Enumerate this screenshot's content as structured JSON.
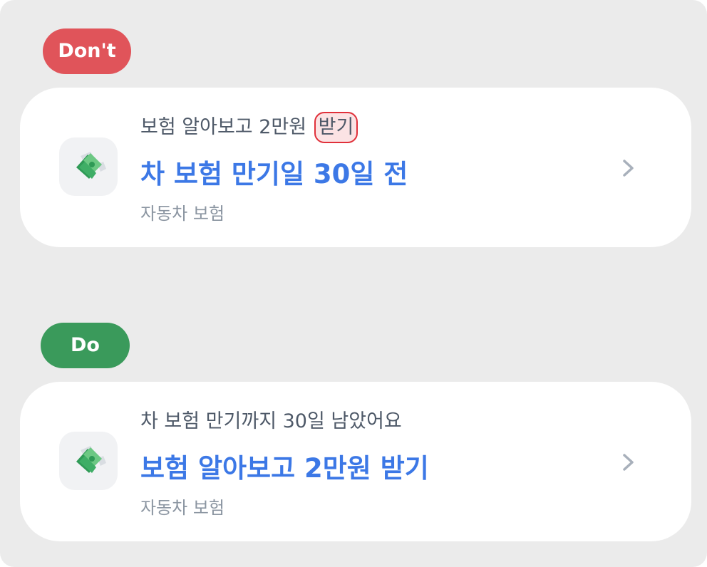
{
  "dont": {
    "badge_label": "Don't",
    "card": {
      "small_prefix": "보험 알아보고 2만원",
      "small_highlight": "받기",
      "big": "차 보험 만기일 30일 전",
      "category": "자동차 보험",
      "icon": "money-bills-icon",
      "chevron": "chevron-right-icon"
    }
  },
  "do": {
    "badge_label": "Do",
    "card": {
      "small": "차 보험 만기까지 30일 남았어요",
      "big": "보험 알아보고 2만원 받기",
      "category": "자동차 보험",
      "icon": "money-bills-icon",
      "chevron": "chevron-right-icon"
    }
  },
  "colors": {
    "dont_badge": "#e0545a",
    "do_badge": "#3a9a5b",
    "title_blue": "#3c78e6",
    "highlight_border": "#e0303a"
  }
}
